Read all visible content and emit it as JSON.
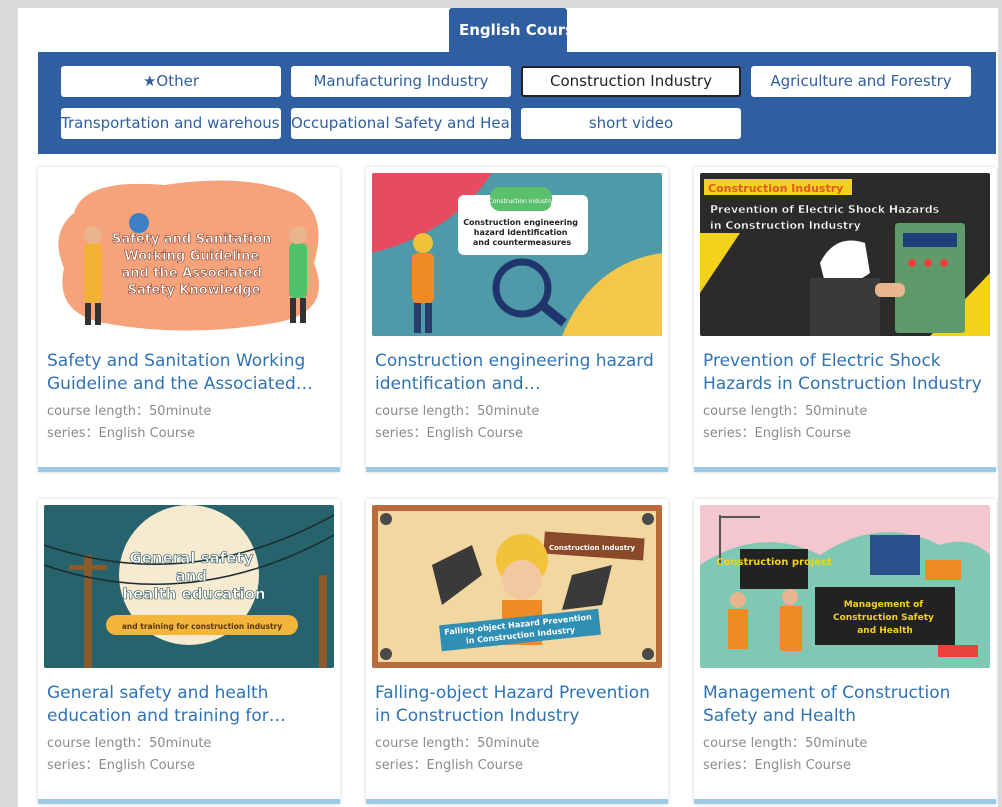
{
  "tab": {
    "label": "English Course"
  },
  "filters": [
    {
      "label": "★Other",
      "active": false
    },
    {
      "label": "Manufacturing Industry",
      "active": false
    },
    {
      "label": "Construction Industry",
      "active": true
    },
    {
      "label": "Agriculture and Forestry",
      "active": false
    },
    {
      "label": "Transportation and warehousing",
      "active": false
    },
    {
      "label": "Occupational Safety and Health",
      "active": false
    },
    {
      "label": "short video",
      "active": false
    }
  ],
  "courses": [
    {
      "title": "Safety and Sanitation Working Guideline and the Associated Safety Knowledge",
      "length": "course length：50minute",
      "series": "series：English Course",
      "thumb_text": [
        "Safety and Sanitation",
        "Working Guideline",
        "and the Associated",
        "Safety Knowledge"
      ]
    },
    {
      "title": "Construction engineering hazard identification and countermeasures",
      "length": "course length：50minute",
      "series": "series：English Course",
      "thumb_badge": "Construction industry",
      "thumb_text": [
        "Construction engineering",
        "hazard identification",
        "and countermeasures"
      ]
    },
    {
      "title": "Prevention of Electric Shock Hazards in Construction Industry",
      "length": "course length：50minute",
      "series": "series：English Course",
      "thumb_badge": "Construction Industry",
      "thumb_text": [
        "Prevention of Electric Shock Hazards",
        "in Construction Industry"
      ]
    },
    {
      "title": "General safety and health education and training for construction industry",
      "length": "course length：50minute",
      "series": "series：English Course",
      "thumb_text": [
        "General safety",
        "and",
        "health education"
      ],
      "thumb_ribbon": "and training for construction industry"
    },
    {
      "title": "Falling-object Hazard Prevention in Construction Industry",
      "length": "course length：50minute",
      "series": "series：English Course",
      "thumb_badge": "Construction Industry",
      "thumb_text": [
        "Falling-object Hazard Prevention",
        "in Construction Industry"
      ]
    },
    {
      "title": "Management of Construction Safety and Health",
      "length": "course length：50minute",
      "series": "series：English Course",
      "thumb_badge": "Construction project",
      "thumb_text": [
        "Management of",
        "Construction Safety",
        "and Health"
      ]
    }
  ],
  "colors": {
    "primary": "#2f5fa0",
    "link": "#2f73b5",
    "muted": "#8b8b8b",
    "accent_bar": "#9ccbe6"
  }
}
